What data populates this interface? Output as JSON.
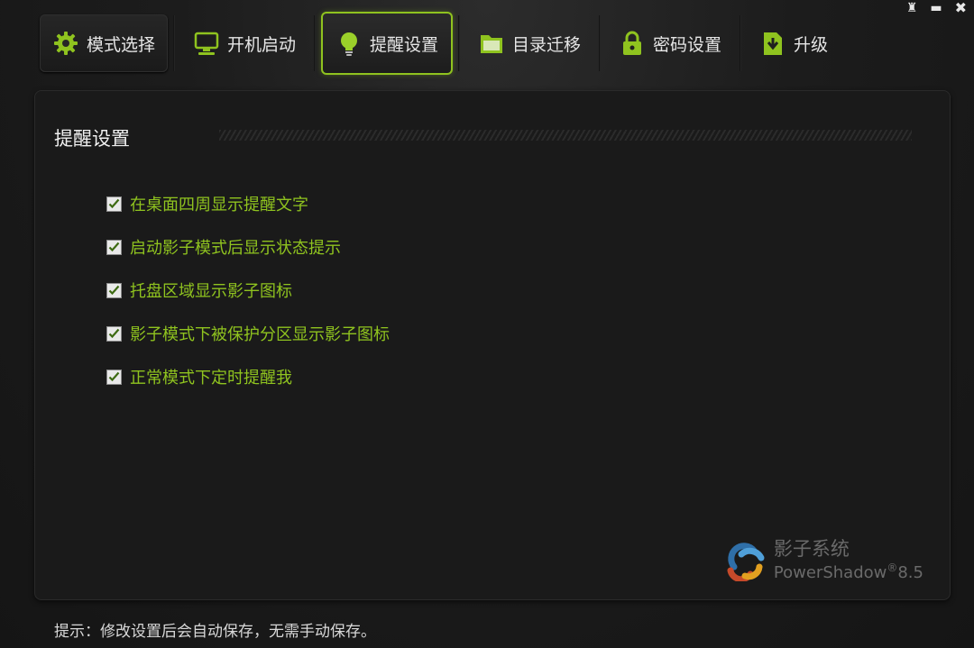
{
  "window": {
    "controls": {
      "skin": "♜",
      "minimize": "▬",
      "close": "✖"
    }
  },
  "tabs": [
    {
      "label": "模式选择",
      "icon": "gear-icon"
    },
    {
      "label": "开机启动",
      "icon": "monitor-icon"
    },
    {
      "label": "提醒设置",
      "icon": "lightbulb-icon",
      "active": true
    },
    {
      "label": "目录迁移",
      "icon": "folder-icon"
    },
    {
      "label": "密码设置",
      "icon": "lock-icon"
    },
    {
      "label": "升级",
      "icon": "download-icon"
    }
  ],
  "section": {
    "title": "提醒设置"
  },
  "options": [
    {
      "label": "在桌面四周显示提醒文字",
      "checked": true
    },
    {
      "label": "启动影子模式后显示状态提示",
      "checked": true
    },
    {
      "label": "托盘区域显示影子图标",
      "checked": true
    },
    {
      "label": "影子模式下被保护分区显示影子图标",
      "checked": true
    },
    {
      "label": "正常模式下定时提醒我",
      "checked": true
    }
  ],
  "logo": {
    "name_cn": "影子系统",
    "name_en": "PowerShadow",
    "reg": "®",
    "version": "8.5"
  },
  "footer": {
    "hint": "提示：修改设置后会自动保存，无需手动保存。"
  },
  "colors": {
    "accent": "#8fc31f",
    "background": "#1a1a1a",
    "text": "#e6e6e6"
  }
}
